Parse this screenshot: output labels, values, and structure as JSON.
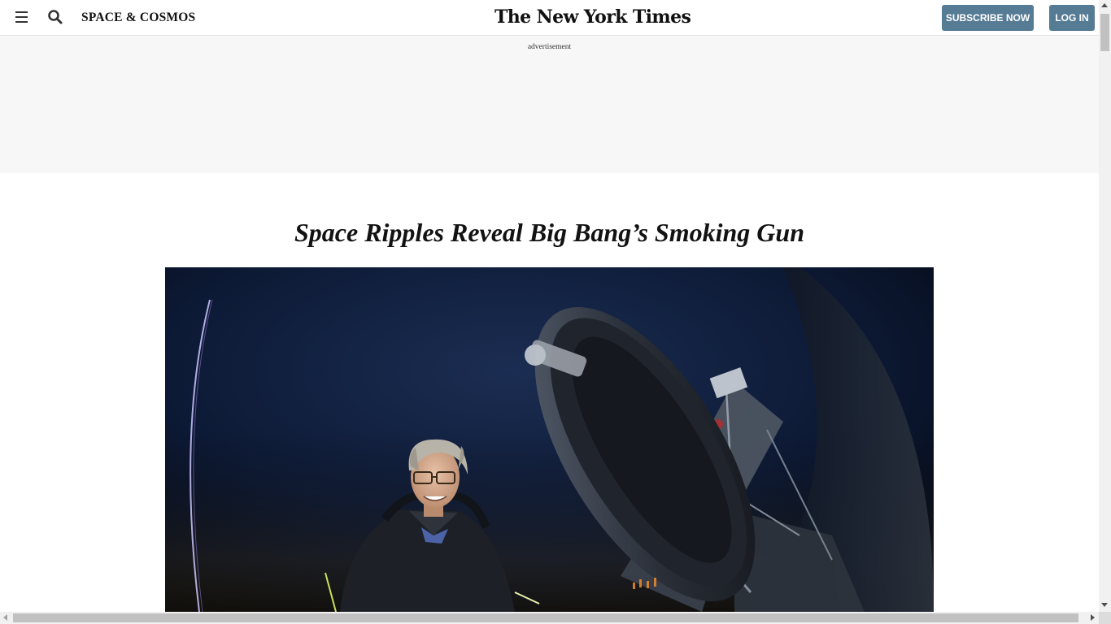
{
  "header": {
    "menu_icon": "hamburger-menu-icon",
    "search_icon": "search-icon",
    "section_label": "SPACE & COSMOS",
    "logo_text": "The New York Times",
    "subscribe_label": "SUBSCRIBE NOW",
    "login_label": "LOG IN",
    "button_color": "#567b95"
  },
  "ad": {
    "label": "advertisement"
  },
  "article": {
    "headline": "Space Ripples Reveal Big Bang’s Smoking Gun"
  },
  "colors": {
    "ad_background": "#f7f7f7",
    "photo_night_sky": "#0a1122"
  }
}
